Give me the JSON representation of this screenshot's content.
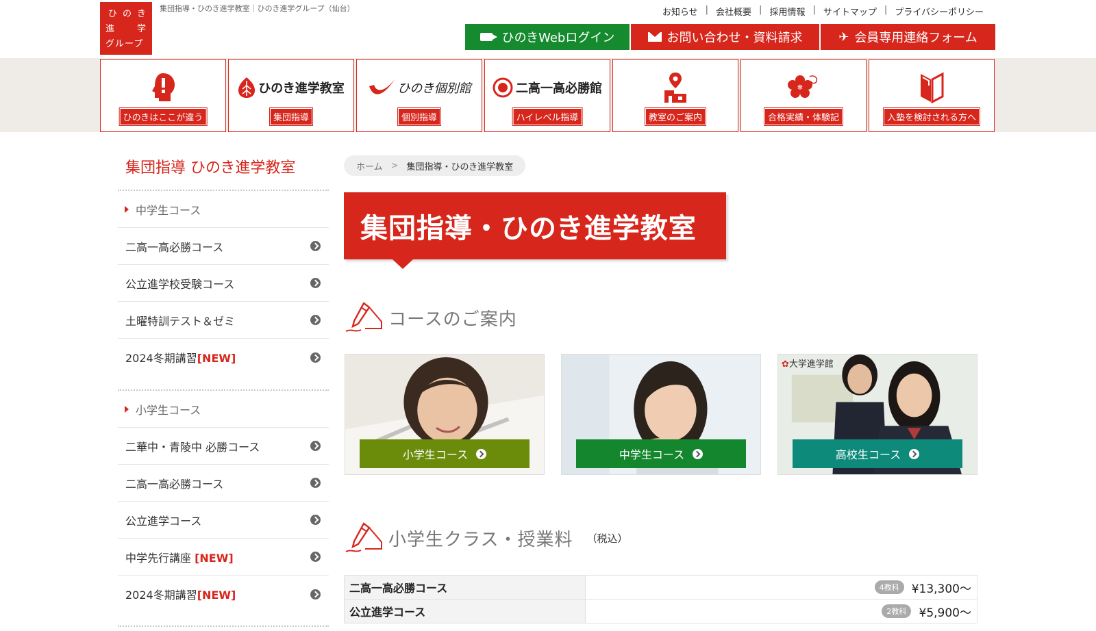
{
  "logo": {
    "chars": [
      "ひ",
      "の",
      "き",
      "進",
      "学",
      "グループ"
    ]
  },
  "tagline": "集団指導・ひのき進学教室｜ひのき進学グループ（仙台）",
  "top_links": [
    "お知らせ",
    "会社概要",
    "採用情報",
    "サイトマップ",
    "プライバシーポリシー"
  ],
  "separator": "|",
  "header_buttons": {
    "web_login": "ひのきWebログイン",
    "contact": "お問い合わせ・資料請求",
    "members": "会員専用連絡フォーム"
  },
  "categories": [
    {
      "label": "ひのきはここが違う"
    },
    {
      "label": "集団指導",
      "brand": "ひのき進学教室"
    },
    {
      "label": "個別指導",
      "brand": "ひのき個別館"
    },
    {
      "label": "ハイレベル指導",
      "brand": "二高一高必勝館"
    },
    {
      "label": "教室のご案内"
    },
    {
      "label": "合格実績・体験記"
    },
    {
      "label": "入塾を検討される方へ"
    }
  ],
  "sidebar": {
    "title": "集団指導 ひのき進学教室",
    "middle": {
      "heading": "中学生コース",
      "items": [
        {
          "text": "二高一高必勝コース",
          "new": ""
        },
        {
          "text": "公立進学校受験コース",
          "new": ""
        },
        {
          "text": "土曜特訓テスト＆ゼミ",
          "new": ""
        },
        {
          "text": "2024冬期講習",
          "new": "[NEW]"
        }
      ]
    },
    "elementary": {
      "heading": "小学生コース",
      "items": [
        {
          "text": "二華中・青陵中 必勝コース",
          "new": ""
        },
        {
          "text": "二高一高必勝コース",
          "new": ""
        },
        {
          "text": "公立進学コース",
          "new": ""
        },
        {
          "text": "中学先行講座 ",
          "new": "[NEW]"
        },
        {
          "text": "2024冬期講習",
          "new": "[NEW]"
        }
      ]
    }
  },
  "breadcrumb": {
    "home": "ホーム",
    "separator": ">",
    "current": "集団指導・ひのき進学教室"
  },
  "page_title": "集団指導・ひのき進学教室",
  "courses_section": {
    "title": "コースのご案内",
    "cards": [
      {
        "label": "小学生コース",
        "color": "#6a8c0a"
      },
      {
        "label": "中学生コース",
        "color": "#14862d"
      },
      {
        "label": "高校生コース",
        "color": "#0e8a7b",
        "school": "大学進学館"
      }
    ]
  },
  "fees_section": {
    "title": "小学生クラス・授業料",
    "note": "（税込）",
    "rows": [
      {
        "name": "二高一高必勝コース",
        "badge": "4教科",
        "price": "¥13,300〜"
      },
      {
        "name": "公立進学コース",
        "badge": "2教科",
        "price": "¥5,900〜"
      }
    ]
  },
  "colors": {
    "brand_red": "#d7261c",
    "login_green": "#158a2e",
    "nav_band": "#efece8"
  }
}
